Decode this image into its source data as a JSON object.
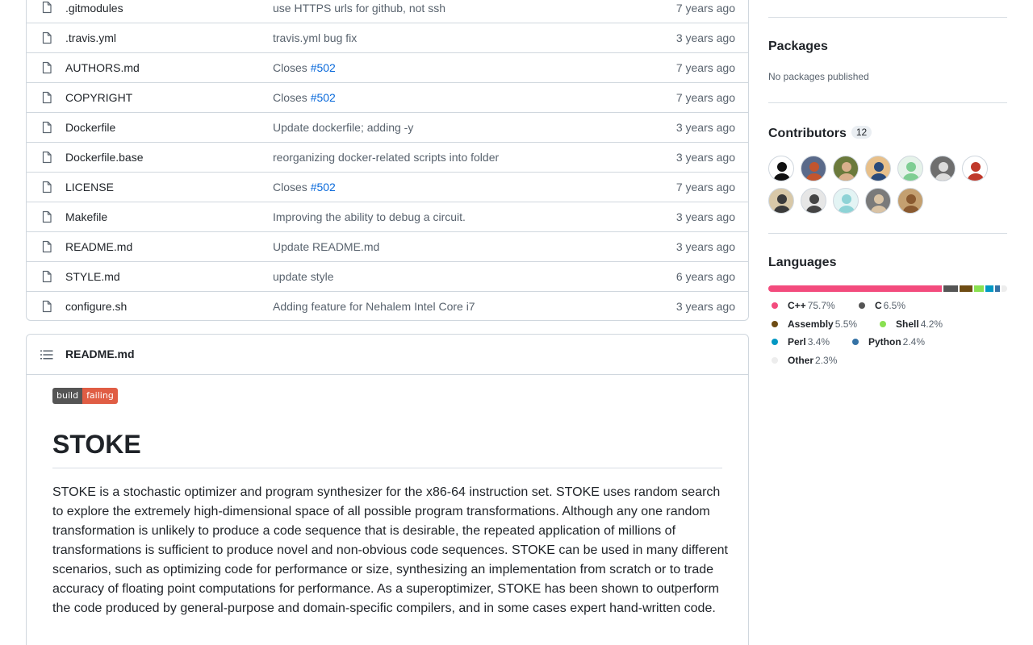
{
  "files": [
    {
      "name": ".gitmodules",
      "message": "use HTTPS urls for github, not ssh",
      "issue": "",
      "age": "7 years ago"
    },
    {
      "name": ".travis.yml",
      "message": "travis.yml bug fix",
      "issue": "",
      "age": "3 years ago"
    },
    {
      "name": "AUTHORS.md",
      "message": "Closes ",
      "issue": "#502",
      "age": "7 years ago"
    },
    {
      "name": "COPYRIGHT",
      "message": "Closes ",
      "issue": "#502",
      "age": "7 years ago"
    },
    {
      "name": "Dockerfile",
      "message": "Update dockerfile; adding -y",
      "issue": "",
      "age": "3 years ago"
    },
    {
      "name": "Dockerfile.base",
      "message": "reorganizing docker-related scripts into folder",
      "issue": "",
      "age": "3 years ago"
    },
    {
      "name": "LICENSE",
      "message": "Closes ",
      "issue": "#502",
      "age": "7 years ago"
    },
    {
      "name": "Makefile",
      "message": "Improving the ability to debug a circuit.",
      "issue": "",
      "age": "3 years ago"
    },
    {
      "name": "README.md",
      "message": "Update README.md",
      "issue": "",
      "age": "3 years ago"
    },
    {
      "name": "STYLE.md",
      "message": "update style",
      "issue": "",
      "age": "6 years ago"
    },
    {
      "name": "configure.sh",
      "message": "Adding feature for Nehalem Intel Core i7",
      "issue": "",
      "age": "3 years ago"
    }
  ],
  "readme": {
    "header_title": "README.md",
    "badge_left": "build",
    "badge_right": "failing",
    "heading": "STOKE",
    "paragraph": "STOKE is a stochastic optimizer and program synthesizer for the x86-64 instruction set. STOKE uses random search to explore the extremely high-dimensional space of all possible program transformations. Although any one random transformation is unlikely to produce a code sequence that is desirable, the repeated application of millions of transformations is sufficient to produce novel and non-obvious code sequences. STOKE can be used in many different scenarios, such as optimizing code for performance or size, synthesizing an implementation from scratch or to trade accuracy of floating point computations for performance. As a superoptimizer, STOKE has been shown to outperform the code produced by general-purpose and domain-specific compilers, and in some cases expert hand-written code."
  },
  "sidebar": {
    "packages_title": "Packages",
    "packages_text": "No packages published",
    "contributors_title": "Contributors",
    "contributors_count": "12",
    "avatars": [
      {
        "bg": "#ffffff",
        "fg": "#111111"
      },
      {
        "bg": "#5a6a8a",
        "fg": "#c2552e"
      },
      {
        "bg": "#6b7a3c",
        "fg": "#d9b08c"
      },
      {
        "bg": "#e8c08a",
        "fg": "#2a4a7a"
      },
      {
        "bg": "#e6f3ea",
        "fg": "#7fce93"
      },
      {
        "bg": "#6e6e6e",
        "fg": "#dcdcdc"
      },
      {
        "bg": "#ffffff",
        "fg": "#c0392b"
      },
      {
        "bg": "#d8c8a8",
        "fg": "#3b3b3b"
      },
      {
        "bg": "#e6e6e6",
        "fg": "#444444"
      },
      {
        "bg": "#e3f4f4",
        "fg": "#8ed3d6"
      },
      {
        "bg": "#7a7a7a",
        "fg": "#d9c3a5"
      },
      {
        "bg": "#c4a070",
        "fg": "#8a5a30"
      }
    ],
    "languages_title": "Languages",
    "languages": [
      {
        "name": "C++",
        "pct": "75.7%",
        "value": 75.7,
        "color": "#f34b7d"
      },
      {
        "name": "C",
        "pct": "6.5%",
        "value": 6.5,
        "color": "#555555"
      },
      {
        "name": "Assembly",
        "pct": "5.5%",
        "value": 5.5,
        "color": "#6e4c13"
      },
      {
        "name": "Shell",
        "pct": "4.2%",
        "value": 4.2,
        "color": "#89e051"
      },
      {
        "name": "Perl",
        "pct": "3.4%",
        "value": 3.4,
        "color": "#0298c3"
      },
      {
        "name": "Python",
        "pct": "2.4%",
        "value": 2.4,
        "color": "#3572a5"
      },
      {
        "name": "Other",
        "pct": "2.3%",
        "value": 2.3,
        "color": "#ededed"
      }
    ]
  }
}
